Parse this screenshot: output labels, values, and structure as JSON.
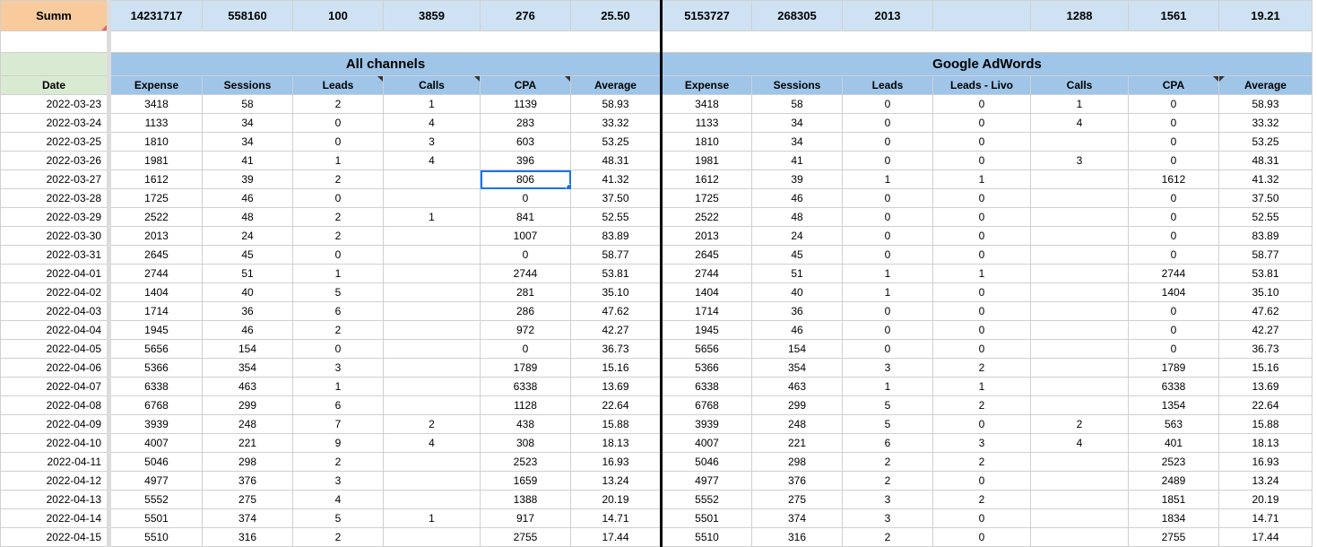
{
  "summary": {
    "label": "Summ",
    "all_channels": [
      "14231717",
      "558160",
      "100",
      "3859",
      "276",
      "25.50"
    ],
    "google": [
      "5153727",
      "268305",
      "2013",
      "",
      "1288",
      "1561",
      "19.21"
    ]
  },
  "groups": {
    "all_channels": "All channels",
    "google": "Google AdWords"
  },
  "columns": {
    "date": "Date",
    "all_channels": [
      "Expense",
      "Sessions",
      "Leads",
      "Calls",
      "CPA",
      "Average"
    ],
    "google": [
      "Expense",
      "Sessions",
      "Leads",
      "Leads - Livo",
      "Calls",
      "CPA",
      "Average"
    ]
  },
  "rows": [
    [
      "2022-03-23",
      "3418",
      "58",
      "2",
      "1",
      "1139",
      "58.93",
      "3418",
      "58",
      "0",
      "0",
      "1",
      "0",
      "58.93"
    ],
    [
      "2022-03-24",
      "1133",
      "34",
      "0",
      "4",
      "283",
      "33.32",
      "1133",
      "34",
      "0",
      "0",
      "4",
      "0",
      "33.32"
    ],
    [
      "2022-03-25",
      "1810",
      "34",
      "0",
      "3",
      "603",
      "53.25",
      "1810",
      "34",
      "0",
      "0",
      "",
      "0",
      "53.25"
    ],
    [
      "2022-03-26",
      "1981",
      "41",
      "1",
      "4",
      "396",
      "48.31",
      "1981",
      "41",
      "0",
      "0",
      "3",
      "0",
      "48.31"
    ],
    [
      "2022-03-27",
      "1612",
      "39",
      "2",
      "",
      "806",
      "41.32",
      "1612",
      "39",
      "1",
      "1",
      "",
      "1612",
      "41.32"
    ],
    [
      "2022-03-28",
      "1725",
      "46",
      "0",
      "",
      "0",
      "37.50",
      "1725",
      "46",
      "0",
      "0",
      "",
      "0",
      "37.50"
    ],
    [
      "2022-03-29",
      "2522",
      "48",
      "2",
      "1",
      "841",
      "52.55",
      "2522",
      "48",
      "0",
      "0",
      "",
      "0",
      "52.55"
    ],
    [
      "2022-03-30",
      "2013",
      "24",
      "2",
      "",
      "1007",
      "83.89",
      "2013",
      "24",
      "0",
      "0",
      "",
      "0",
      "83.89"
    ],
    [
      "2022-03-31",
      "2645",
      "45",
      "0",
      "",
      "0",
      "58.77",
      "2645",
      "45",
      "0",
      "0",
      "",
      "0",
      "58.77"
    ],
    [
      "2022-04-01",
      "2744",
      "51",
      "1",
      "",
      "2744",
      "53.81",
      "2744",
      "51",
      "1",
      "1",
      "",
      "2744",
      "53.81"
    ],
    [
      "2022-04-02",
      "1404",
      "40",
      "5",
      "",
      "281",
      "35.10",
      "1404",
      "40",
      "1",
      "0",
      "",
      "1404",
      "35.10"
    ],
    [
      "2022-04-03",
      "1714",
      "36",
      "6",
      "",
      "286",
      "47.62",
      "1714",
      "36",
      "0",
      "0",
      "",
      "0",
      "47.62"
    ],
    [
      "2022-04-04",
      "1945",
      "46",
      "2",
      "",
      "972",
      "42.27",
      "1945",
      "46",
      "0",
      "0",
      "",
      "0",
      "42.27"
    ],
    [
      "2022-04-05",
      "5656",
      "154",
      "0",
      "",
      "0",
      "36.73",
      "5656",
      "154",
      "0",
      "0",
      "",
      "0",
      "36.73"
    ],
    [
      "2022-04-06",
      "5366",
      "354",
      "3",
      "",
      "1789",
      "15.16",
      "5366",
      "354",
      "3",
      "2",
      "",
      "1789",
      "15.16"
    ],
    [
      "2022-04-07",
      "6338",
      "463",
      "1",
      "",
      "6338",
      "13.69",
      "6338",
      "463",
      "1",
      "1",
      "",
      "6338",
      "13.69"
    ],
    [
      "2022-04-08",
      "6768",
      "299",
      "6",
      "",
      "1128",
      "22.64",
      "6768",
      "299",
      "5",
      "2",
      "",
      "1354",
      "22.64"
    ],
    [
      "2022-04-09",
      "3939",
      "248",
      "7",
      "2",
      "438",
      "15.88",
      "3939",
      "248",
      "5",
      "0",
      "2",
      "563",
      "15.88"
    ],
    [
      "2022-04-10",
      "4007",
      "221",
      "9",
      "4",
      "308",
      "18.13",
      "4007",
      "221",
      "6",
      "3",
      "4",
      "401",
      "18.13"
    ],
    [
      "2022-04-11",
      "5046",
      "298",
      "2",
      "",
      "2523",
      "16.93",
      "5046",
      "298",
      "2",
      "2",
      "",
      "2523",
      "16.93"
    ],
    [
      "2022-04-12",
      "4977",
      "376",
      "3",
      "",
      "1659",
      "13.24",
      "4977",
      "376",
      "2",
      "0",
      "",
      "2489",
      "13.24"
    ],
    [
      "2022-04-13",
      "5552",
      "275",
      "4",
      "",
      "1388",
      "20.19",
      "5552",
      "275",
      "3",
      "2",
      "",
      "1851",
      "20.19"
    ],
    [
      "2022-04-14",
      "5501",
      "374",
      "5",
      "1",
      "917",
      "14.71",
      "5501",
      "374",
      "3",
      "0",
      "",
      "1834",
      "14.71"
    ],
    [
      "2022-04-15",
      "5510",
      "316",
      "2",
      "",
      "2755",
      "17.44",
      "5510",
      "316",
      "2",
      "0",
      "",
      "2755",
      "17.44"
    ]
  ]
}
